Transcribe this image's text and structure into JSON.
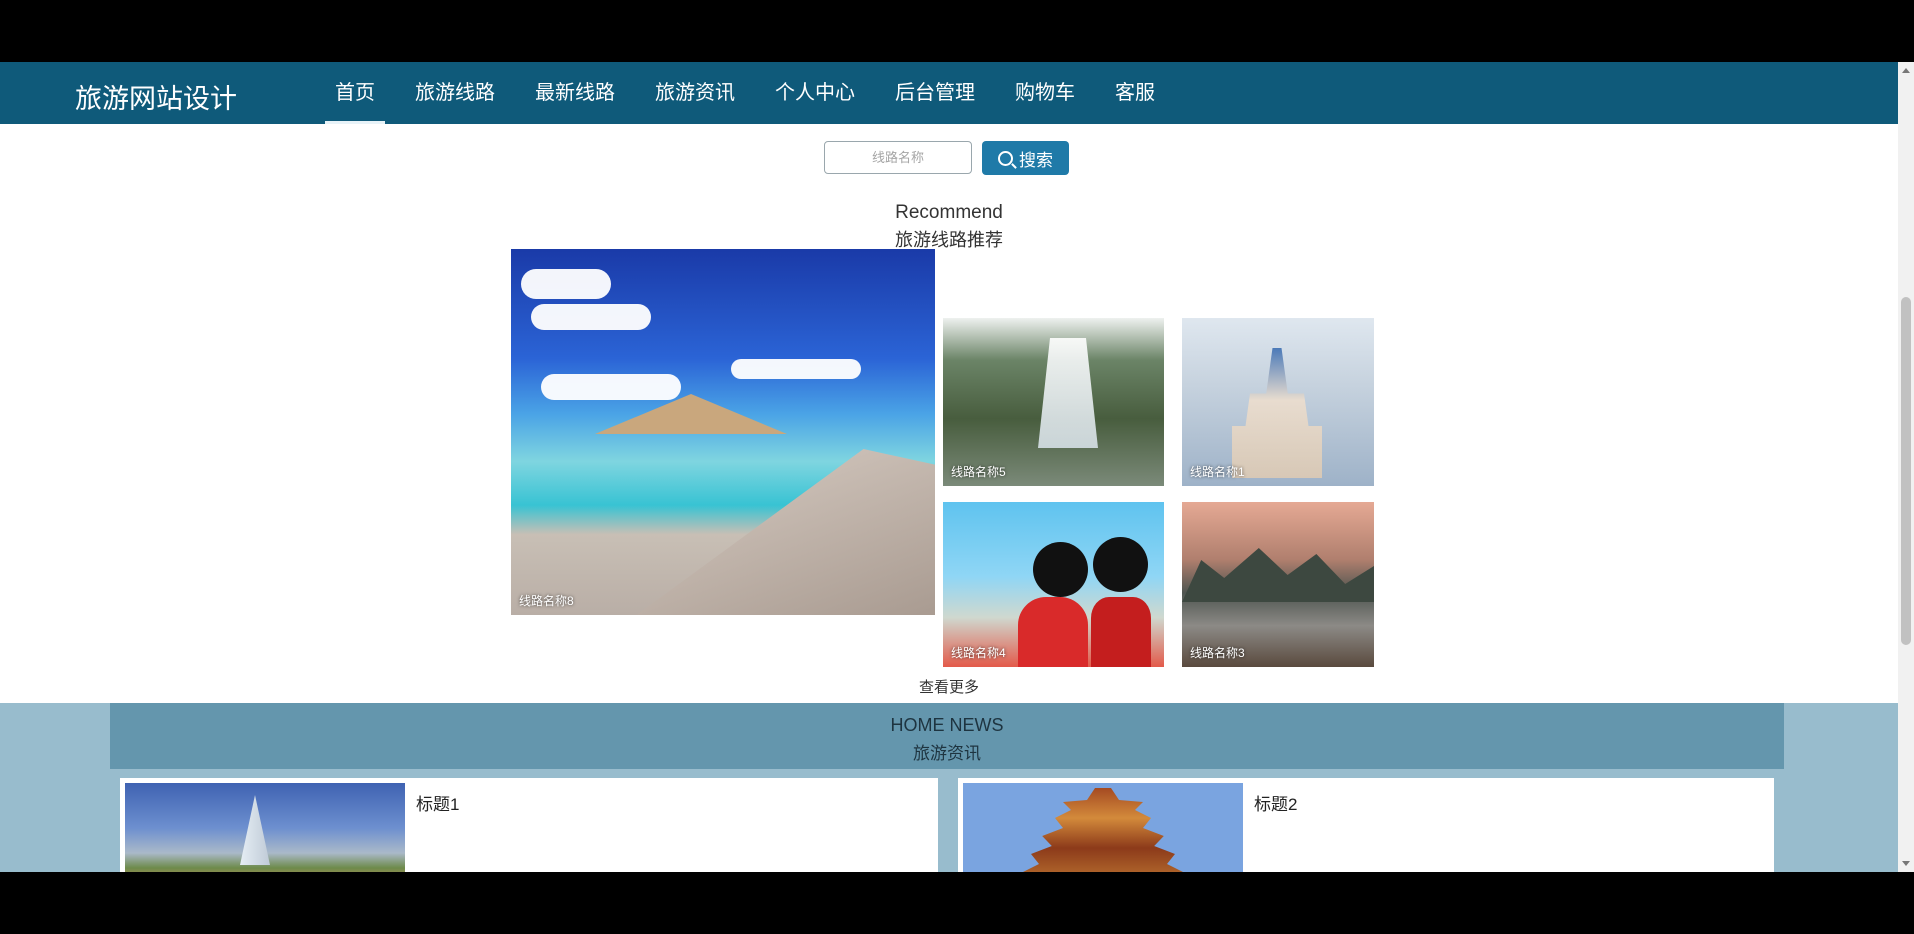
{
  "nav": {
    "brand": "旅游网站设计",
    "items": [
      {
        "label": "首页",
        "active": true
      },
      {
        "label": "旅游线路"
      },
      {
        "label": "最新线路"
      },
      {
        "label": "旅游资讯"
      },
      {
        "label": "个人中心"
      },
      {
        "label": "后台管理"
      },
      {
        "label": "购物车"
      },
      {
        "label": "客服"
      }
    ],
    "bg_color": "#0f5a7a"
  },
  "search": {
    "placeholder": "线路名称",
    "button_label": "搜索",
    "button_color": "#1f7aa8"
  },
  "recommend": {
    "title_en": "Recommend",
    "title_cn": "旅游线路推荐",
    "tiles": [
      {
        "caption": "线路名称8"
      },
      {
        "caption": "线路名称5"
      },
      {
        "caption": "线路名称1"
      },
      {
        "caption": "线路名称4"
      },
      {
        "caption": "线路名称3"
      }
    ],
    "see_more": "查看更多"
  },
  "news": {
    "title_en": "HOME NEWS",
    "title_cn": "旅游资讯",
    "items": [
      {
        "title": "标题1"
      },
      {
        "title": "标题2"
      }
    ],
    "bg_color": "#98bccd"
  }
}
